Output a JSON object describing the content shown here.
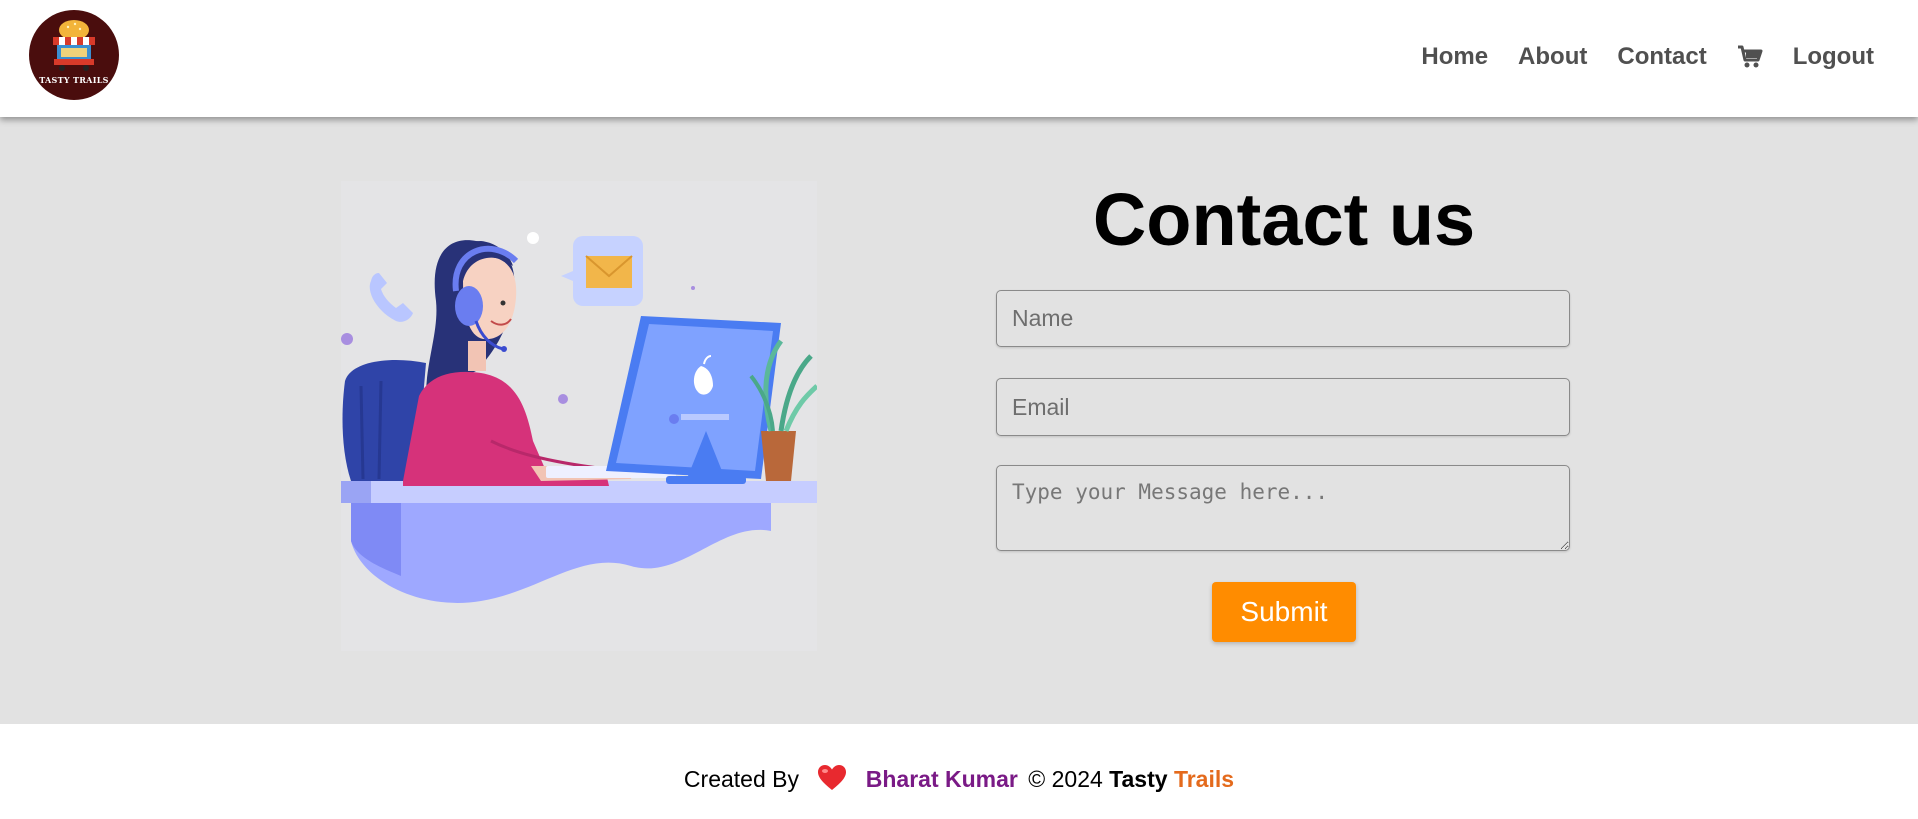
{
  "header": {
    "logo_text": "TASTY TRAILS",
    "nav": {
      "home": "Home",
      "about": "About",
      "contact": "Contact",
      "logout": "Logout"
    },
    "cart_icon": "shopping-cart-icon"
  },
  "contact": {
    "title": "Contact us",
    "name_placeholder": "Name",
    "email_placeholder": "Email",
    "message_placeholder": "Type your Message here...",
    "submit_label": "Submit"
  },
  "footer": {
    "created_by": "Created By",
    "heart_icon": "heart-icon",
    "author": "Bharat Kumar",
    "copyright_symbol": "©",
    "year": "2024",
    "brand_first": "Tasty",
    "brand_second": "Trails"
  },
  "colors": {
    "accent_orange": "#ff8c00",
    "author_purple": "#7a1a86",
    "brand_orange": "#e46a1c",
    "page_background": "#e2e2e2",
    "logo_maroon": "#4a0d0d"
  }
}
